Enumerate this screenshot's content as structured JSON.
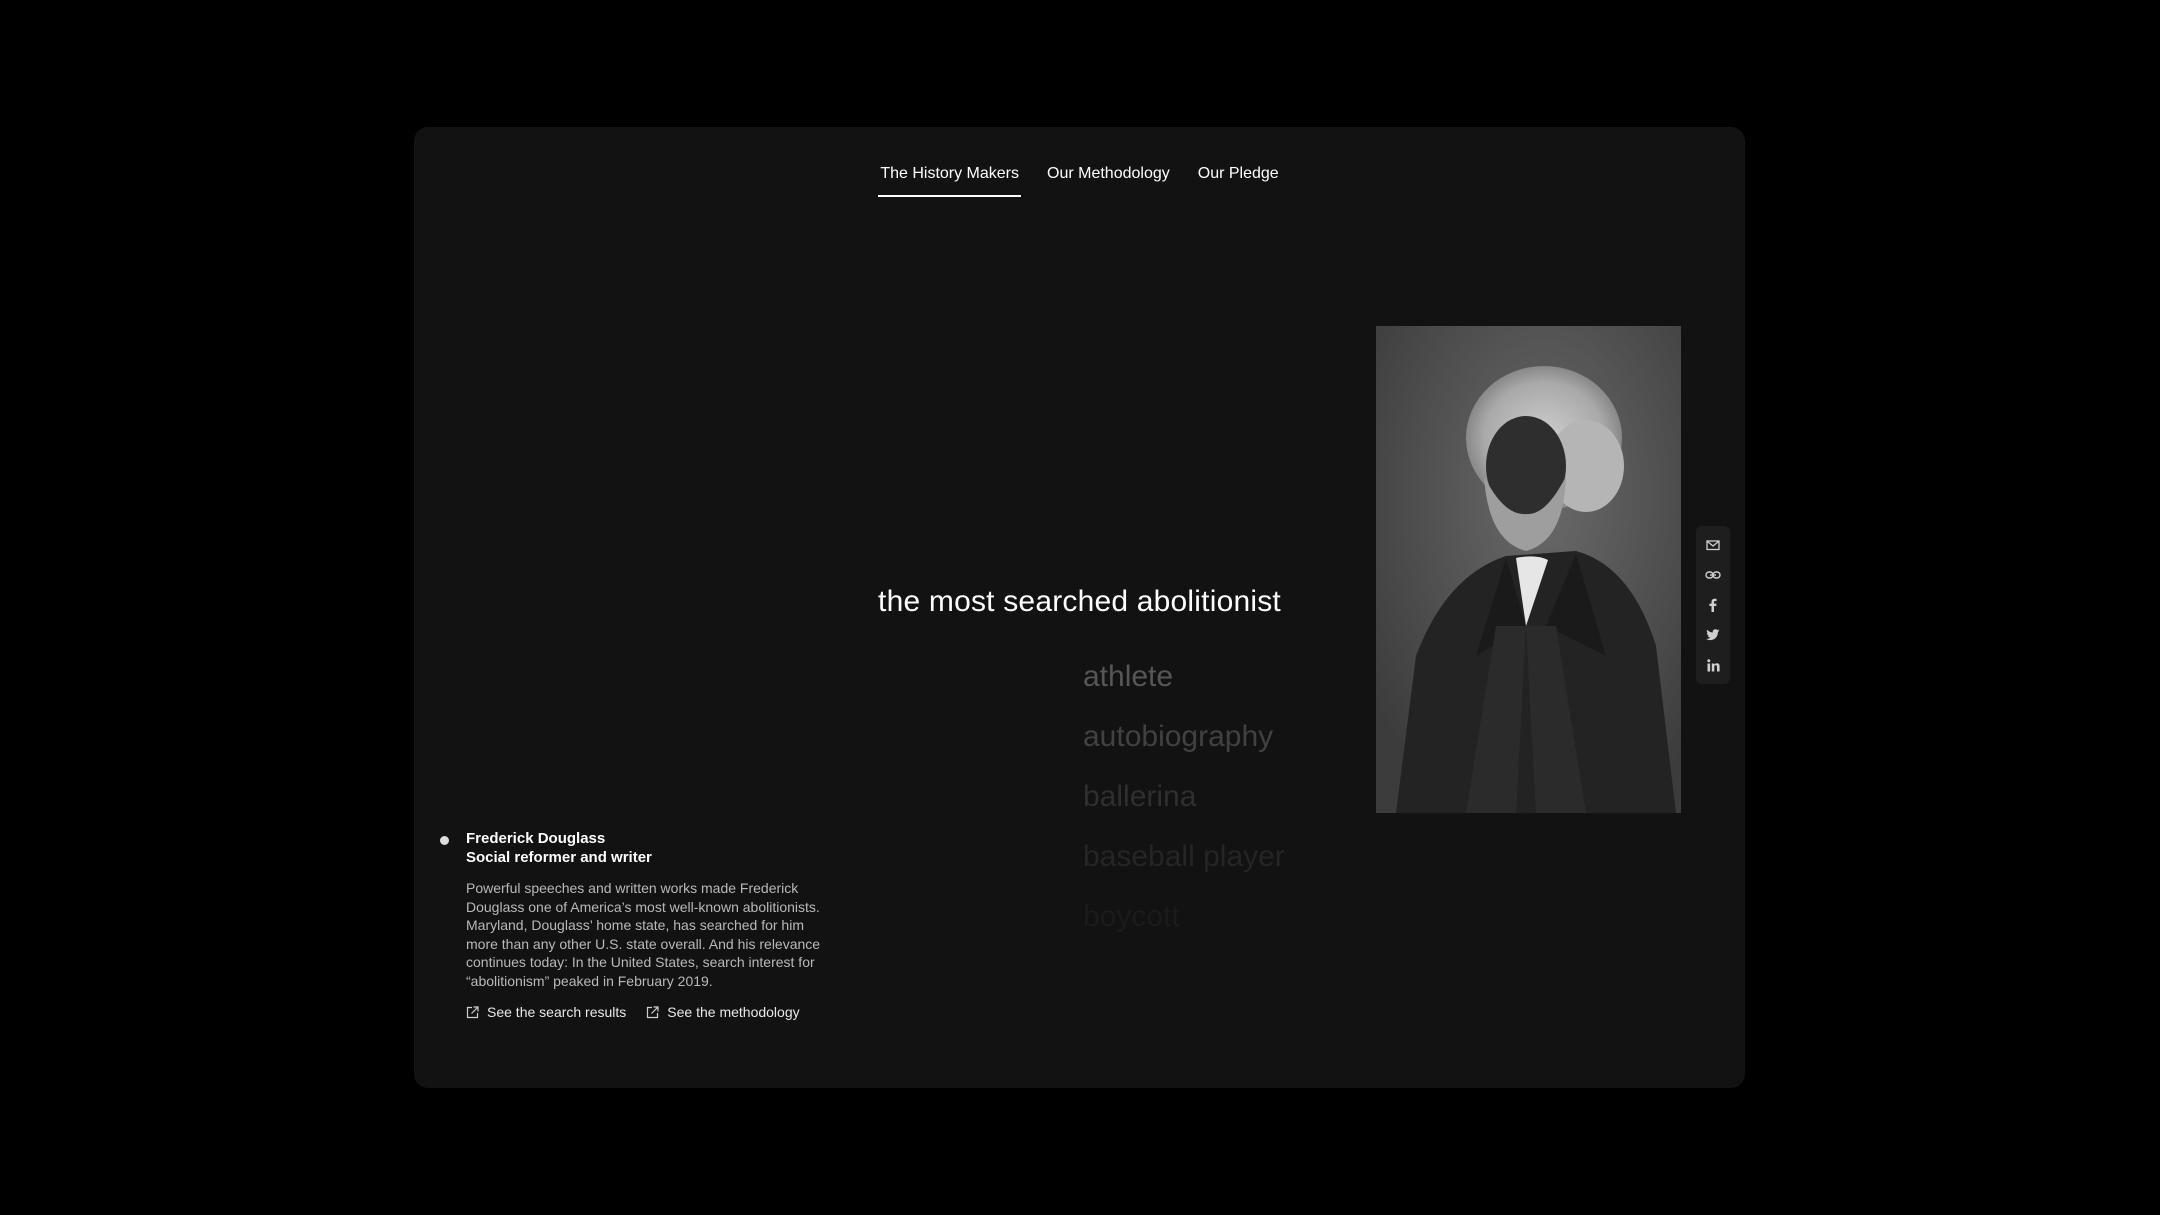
{
  "nav": {
    "items": [
      {
        "label": "The History Makers",
        "active": true
      },
      {
        "label": "Our Methodology",
        "active": false
      },
      {
        "label": "Our Pledge",
        "active": false
      }
    ]
  },
  "hero": {
    "prefix": "the most searched ",
    "current_word": "abolitionist",
    "next_words": [
      "athlete",
      "autobiography",
      "ballerina",
      "baseball player",
      "boycott"
    ]
  },
  "person": {
    "name": "Frederick Douglass",
    "role": "Social reformer and writer",
    "description": "Powerful speeches and written works made Frederick Douglass one of America’s most well-known abolitionists. Maryland, Douglass’ home state, has searched for him more than any other U.S. state overall. And his relevance continues today: In the United States, search interest for “abolitionism” peaked in February 2019.",
    "links": {
      "search_results": "See the search results",
      "methodology": "See the methodology"
    }
  },
  "share": {
    "icons": [
      "mail-icon",
      "link-icon",
      "facebook-icon",
      "twitter-icon",
      "linkedin-icon"
    ]
  },
  "colors": {
    "page_bg": "#000000",
    "frame_bg": "#121212",
    "text": "#ffffff",
    "muted_text": "#b9b9b9"
  }
}
